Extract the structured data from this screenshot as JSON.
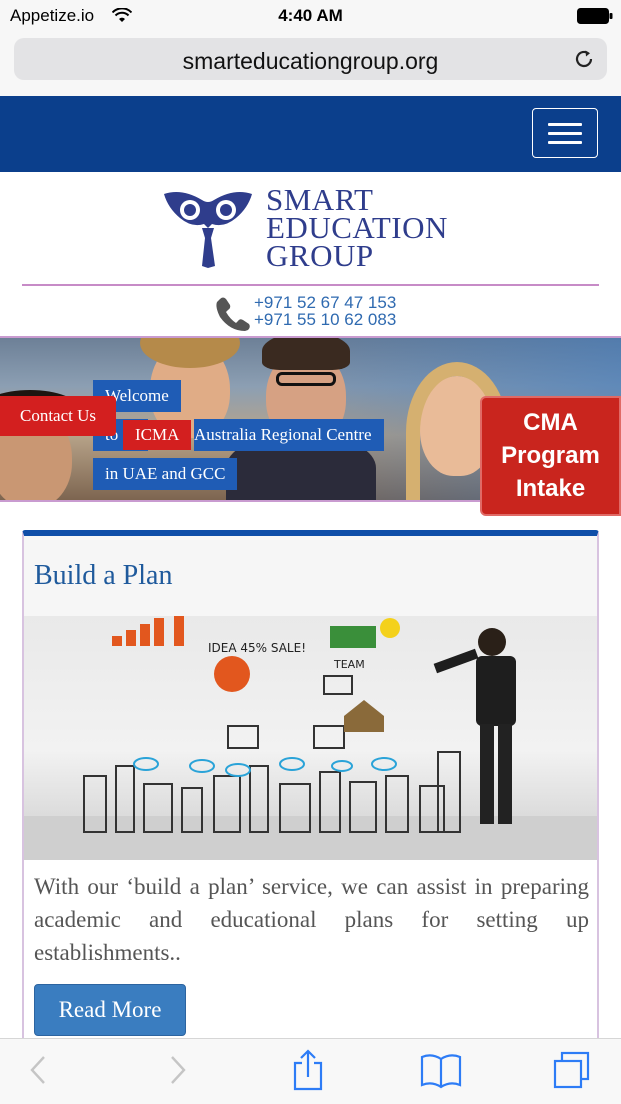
{
  "status_bar": {
    "carrier": "Appetize.io",
    "time": "4:40 AM"
  },
  "browser": {
    "url": "smarteducationgroup.org"
  },
  "logo": {
    "line1": "SMART",
    "line2": "EDUCATION",
    "line3": "GROUP"
  },
  "contact": {
    "phone1": "+971 52 67 47 153",
    "phone2": "+971 55 10 62 083"
  },
  "banner": {
    "welcome_line1": "Welcome",
    "welcome_to": "to",
    "icma": "ICMA",
    "welcome_line2": "Australia Regional Centre",
    "welcome_line3": "in UAE and GCC",
    "contact_button": "Contact Us",
    "cma_line1": "CMA",
    "cma_line2": "Program",
    "cma_line3": "Intake"
  },
  "card": {
    "title": "Build a Plan",
    "body": "With our ‘build a plan’ service, we can assist in preparing academic and educational plans for setting up establishments..",
    "button": "Read More"
  },
  "colors": {
    "nav": "#0b3f8c",
    "accent_red": "#d31f1f",
    "link_blue": "#1f5a9c"
  }
}
